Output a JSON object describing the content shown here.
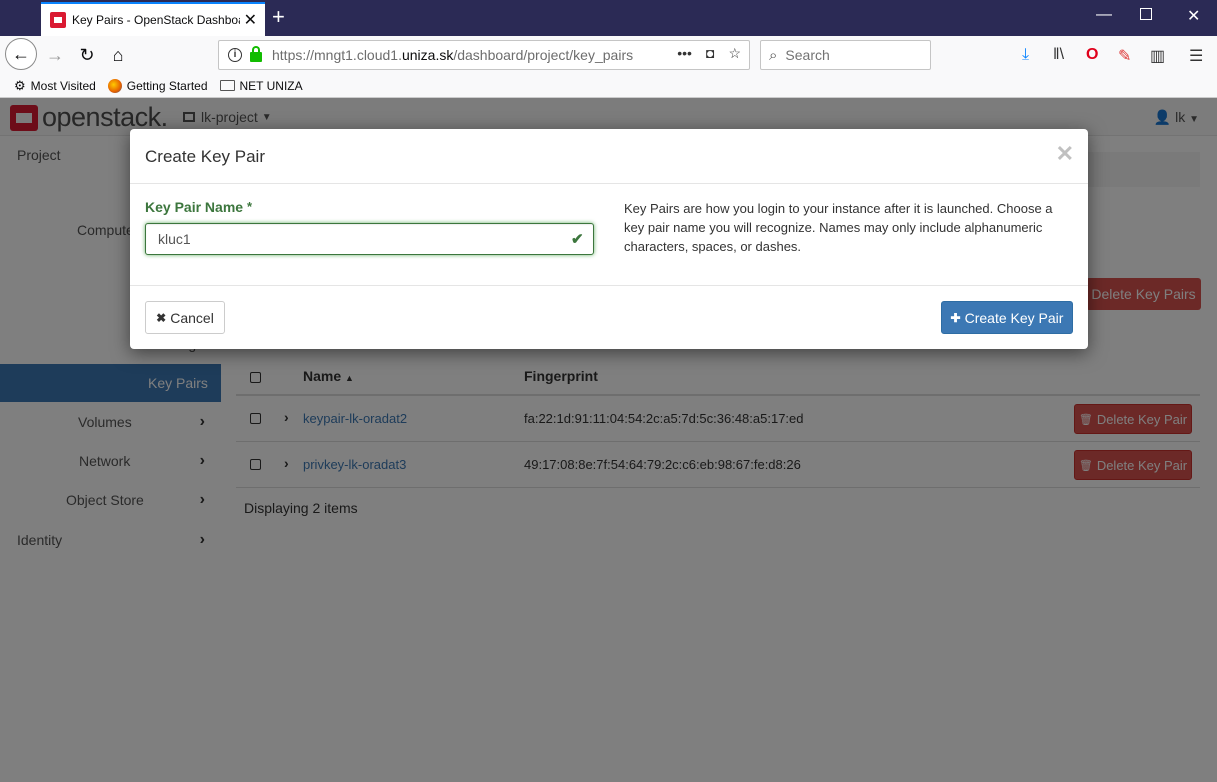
{
  "browser": {
    "tab_title": "Key Pairs - OpenStack Dashboard",
    "url_prefix": "https://mngt1.cloud1.",
    "url_domain": "uniza.sk",
    "url_path": "/dashboard/project/key_pairs",
    "search_placeholder": "Search",
    "bookmarks": [
      "Most Visited",
      "Getting Started",
      "NET UNIZA"
    ]
  },
  "header": {
    "logo_text": "openstack.",
    "project": "lk-project",
    "user": "lk"
  },
  "sidebar": {
    "items": [
      {
        "label": "Project"
      },
      {
        "label": "Compute"
      },
      {
        "label": "Images"
      },
      {
        "label": "Key Pairs"
      },
      {
        "label": "Volumes"
      },
      {
        "label": "Network"
      },
      {
        "label": "Object Store"
      },
      {
        "label": "Identity"
      }
    ]
  },
  "table": {
    "delete_all_label": "Delete Key Pairs",
    "columns": [
      "Name",
      "Fingerprint"
    ],
    "rows": [
      {
        "name": "keypair-lk-oradat2",
        "fingerprint": "fa:22:1d:91:11:04:54:2c:a5:7d:5c:36:48:a5:17:ed",
        "action": "Delete Key Pair"
      },
      {
        "name": "privkey-lk-oradat3",
        "fingerprint": "49:17:08:8e:7f:54:64:79:2c:c6:eb:98:67:fe:d8:26",
        "action": "Delete Key Pair"
      }
    ],
    "footer": "Displaying 2 items"
  },
  "modal": {
    "title": "Create Key Pair",
    "field_label": "Key Pair Name",
    "field_required": "*",
    "field_value": "kluc1",
    "help": "Key Pairs are how you login to your instance after it is launched. Choose a key pair name you will recognize. Names may only include alphanumeric characters, spaces, or dashes.",
    "cancel_label": "Cancel",
    "submit_label": "Create Key Pair"
  },
  "colors": {
    "accent": "#3c78b4",
    "danger": "#d9534f",
    "success": "#3c763d",
    "brand": "#da1a32"
  }
}
